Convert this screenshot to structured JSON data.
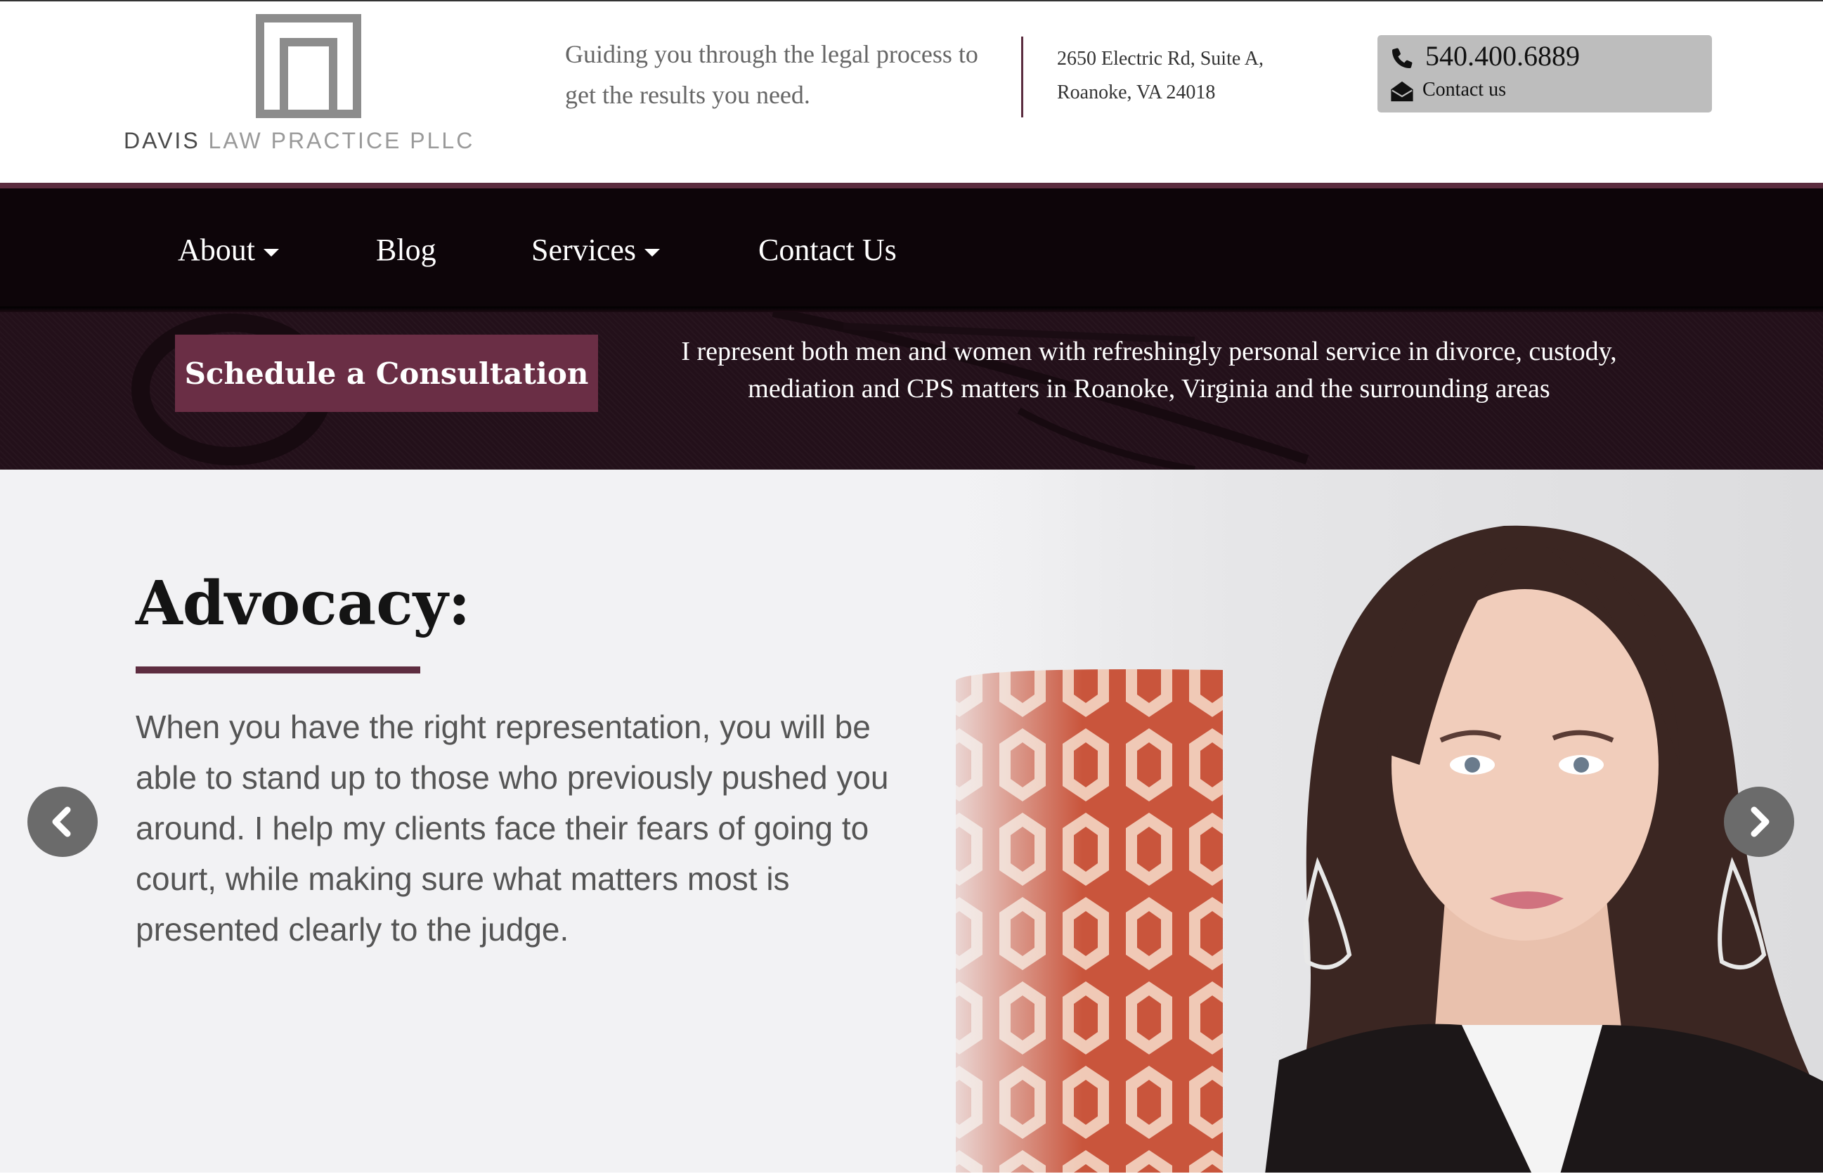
{
  "header": {
    "logo_name_strong": "DAVIS",
    "logo_name_rest": " LAW PRACTICE PLLC",
    "tagline": "Guiding you through the legal process to get the results you need.",
    "address_line1": "2650 Electric Rd, Suite A,",
    "address_line2": "Roanoke, VA 24018",
    "phone": "540.400.6889",
    "contact_label": "Contact us",
    "icons": [
      "phone-icon",
      "envelope-icon"
    ]
  },
  "nav": {
    "items": [
      {
        "label": "About",
        "has_dropdown": true
      },
      {
        "label": "Blog",
        "has_dropdown": false
      },
      {
        "label": "Services",
        "has_dropdown": true
      },
      {
        "label": "Contact Us",
        "has_dropdown": false
      }
    ]
  },
  "banner": {
    "cta_label": "Schedule a Consultation",
    "text": "I represent both men and women with refreshingly personal service in divorce, custody, mediation and CPS matters in Roanoke, Virginia and the surrounding areas"
  },
  "hero": {
    "title": "Advocacy:",
    "body": "When you have the right representation, you will be able to stand up to those who previously pushed you around. I help my clients face their fears of going to court, while making sure what matters most is presented clearly to the judge.",
    "prev_icon": "chevron-left-icon",
    "next_icon": "chevron-right-icon"
  },
  "colors": {
    "brand": "#5b2c3f",
    "button": "#6a2e45",
    "nav_bg": "#0d0509",
    "hero_bg": "#f2f2f4",
    "contact_box": "#bdbdbd"
  }
}
